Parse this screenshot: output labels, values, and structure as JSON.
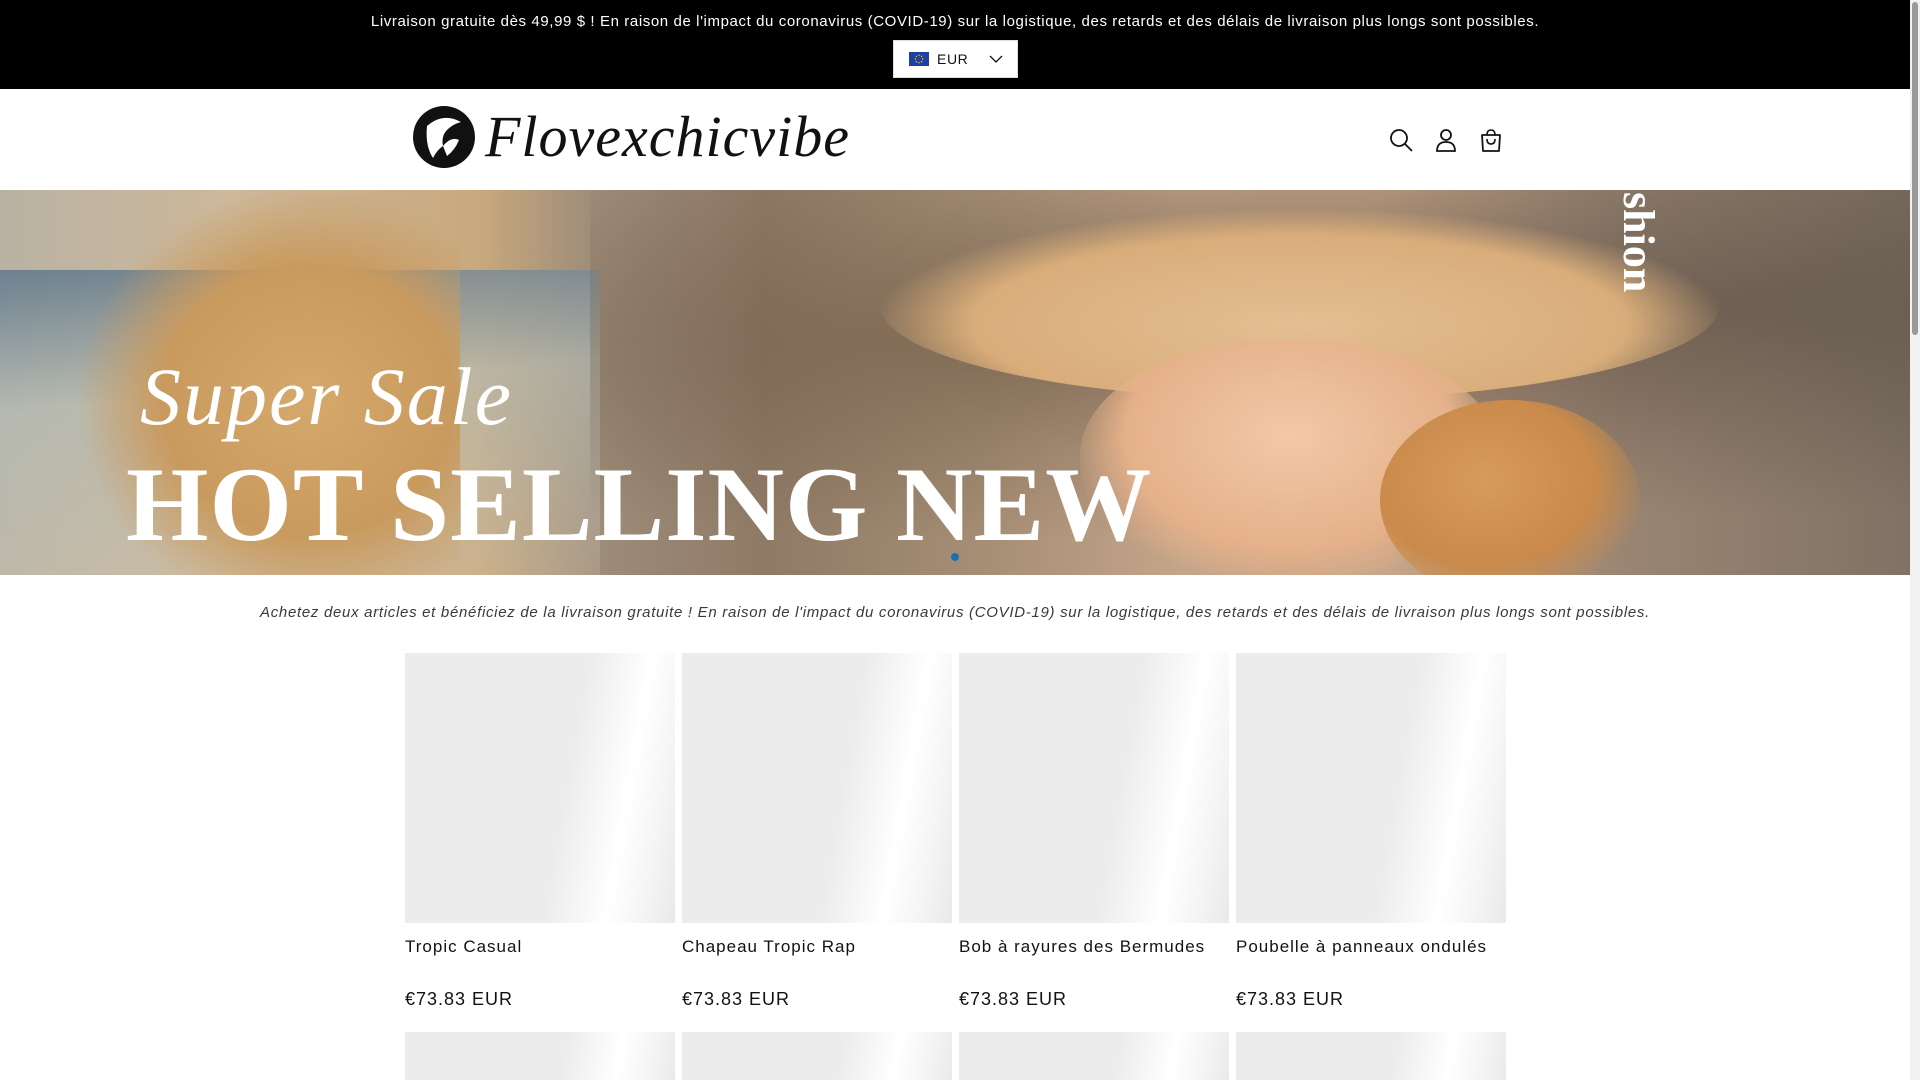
{
  "announcement": {
    "text": "Livraison gratuite dès 49,99 $ ! En raison de l'impact du coronavirus (COVID-19) sur la logistique, des retards et des délais de livraison plus longs sont possibles.",
    "currency": {
      "code": "EUR",
      "flag_icon": "eu-flag-icon",
      "chevron_icon": "chevron-down-icon"
    }
  },
  "header": {
    "logo_text": "Flovexchicvibe",
    "icons": [
      "search-icon",
      "account-icon",
      "cart-icon"
    ]
  },
  "hero": {
    "script_text": "Super Sale",
    "title": "HOT SELLING NEW",
    "side_text": "shion",
    "slide_dot_color": "#1773b0"
  },
  "promo": {
    "text": "Achetez deux articles et bénéficiez de la livraison gratuite ! En raison de l'impact du coronavirus (COVID-19) sur la logistique, des retards et des délais de livraison plus longs sont possibles."
  },
  "products": [
    {
      "name": "Tropic Casual",
      "price": "€73.83 EUR"
    },
    {
      "name": "Chapeau Tropic Rap",
      "price": "€73.83 EUR"
    },
    {
      "name": "Bob à rayures des Bermudes",
      "price": "€73.83 EUR"
    },
    {
      "name": "Poubelle à panneaux ondulés",
      "price": "€73.83 EUR"
    }
  ]
}
